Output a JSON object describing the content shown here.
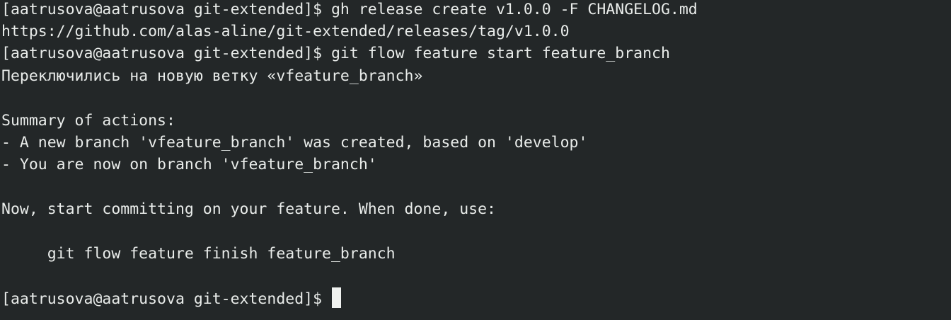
{
  "terminal": {
    "lines": [
      "[aatrusova@aatrusova git-extended]$ gh release create v1.0.0 -F CHANGELOG.md",
      "https://github.com/alas-aline/git-extended/releases/tag/v1.0.0",
      "[aatrusova@aatrusova git-extended]$ git flow feature start feature_branch",
      "Переключились на новую ветку «vfeature_branch»",
      "",
      "Summary of actions:",
      "- A new branch 'vfeature_branch' was created, based on 'develop'",
      "- You are now on branch 'vfeature_branch'",
      "",
      "Now, start committing on your feature. When done, use:",
      "",
      "     git flow feature finish feature_branch",
      "",
      "[aatrusova@aatrusova git-extended]$ "
    ],
    "colors": {
      "background": "#232728",
      "foreground": "#e9ecea",
      "cursor": "#f0f2f0"
    }
  }
}
